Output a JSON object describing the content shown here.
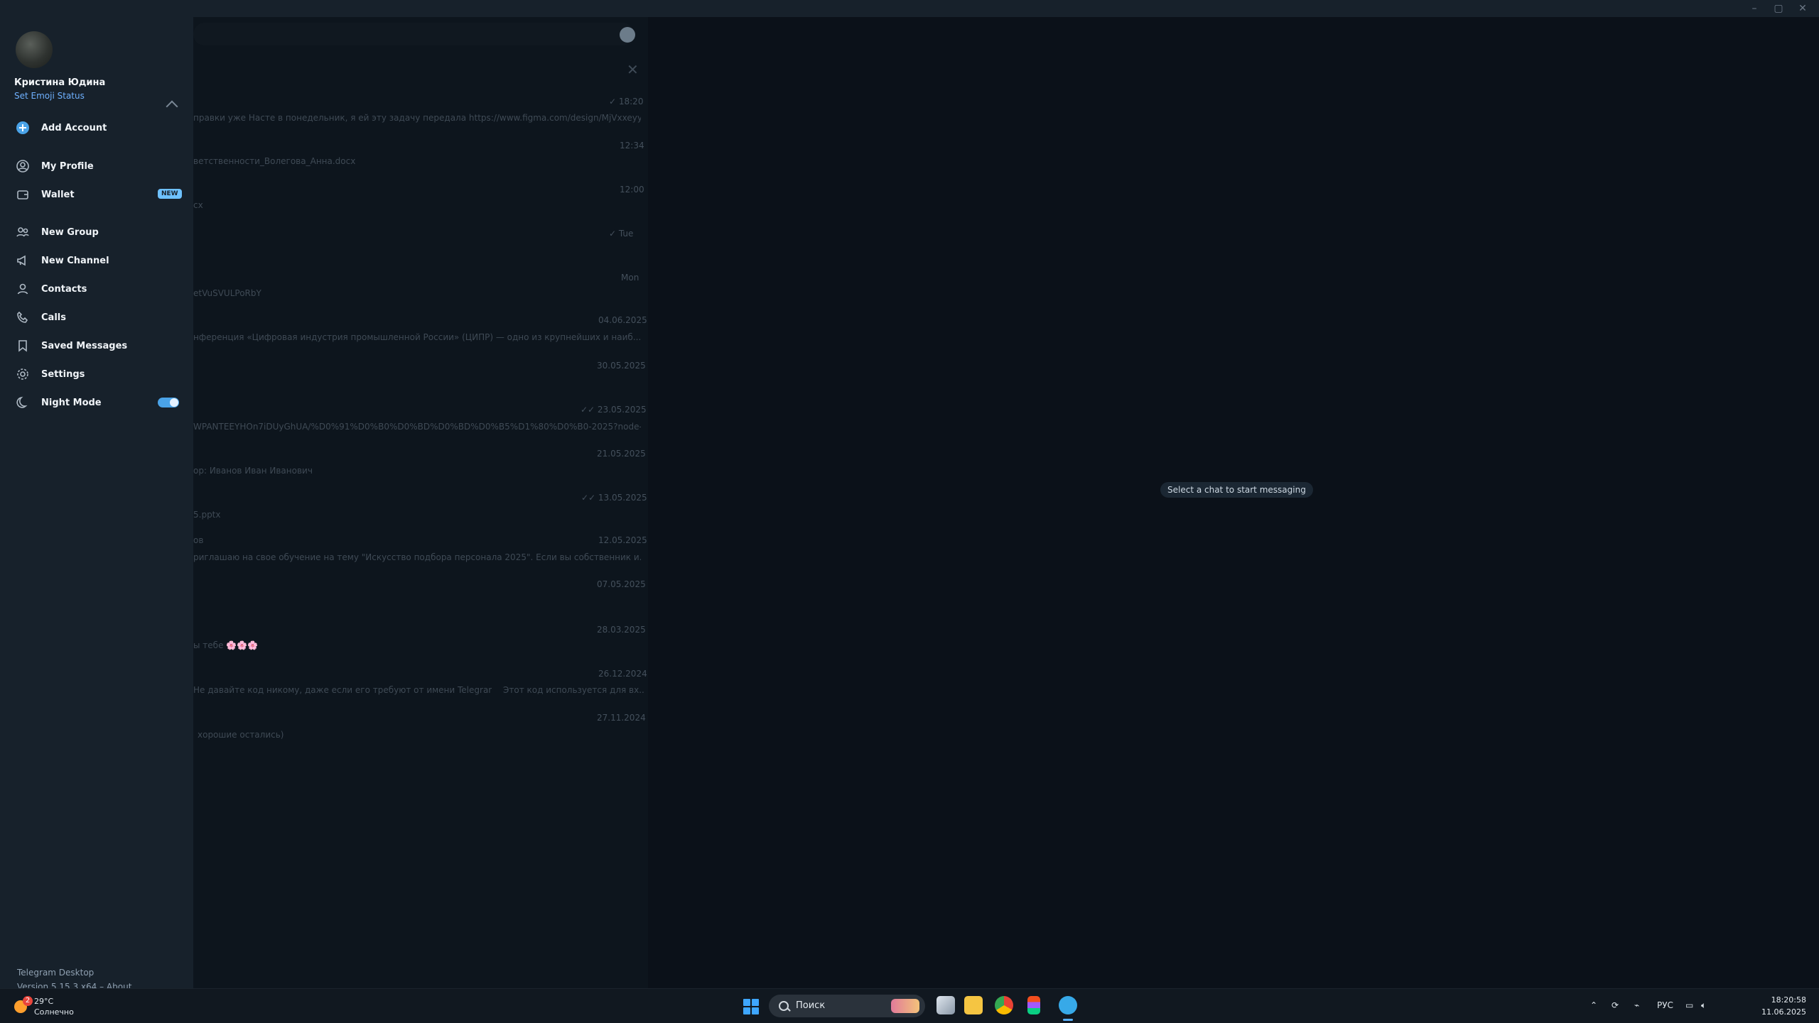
{
  "window_controls": {
    "minimize": "–",
    "maximize": "▢",
    "close": "✕"
  },
  "sidebar": {
    "user_name": "Кристина Юдина",
    "user_status": "Set Emoji Status",
    "items": [
      {
        "label": "Add Account",
        "icon": "plus-circle-icon"
      },
      {
        "label": "My Profile",
        "icon": "profile-icon"
      },
      {
        "label": "Wallet",
        "icon": "wallet-icon",
        "badge": "NEW"
      },
      {
        "label": "New Group",
        "icon": "group-icon"
      },
      {
        "label": "New Channel",
        "icon": "megaphone-icon"
      },
      {
        "label": "Contacts",
        "icon": "contacts-icon"
      },
      {
        "label": "Calls",
        "icon": "phone-icon"
      },
      {
        "label": "Saved Messages",
        "icon": "bookmark-icon"
      },
      {
        "label": "Settings",
        "icon": "gear-icon"
      },
      {
        "label": "Night Mode",
        "icon": "moon-icon",
        "toggle_on": true
      }
    ],
    "footer_title": "Telegram Desktop",
    "footer_version": "Version 5.15.3 x64 – About"
  },
  "chatlist": {
    "rows": [
      {
        "text": "правки уже Насте в понедельник, я ей эту задачу передала  https://www.figma.com/design/MjVxxeyy2...",
        "time": "✓ 18:20"
      },
      {
        "text": "",
        "time": "12:34"
      },
      {
        "text": "ветственности_Волегова_Анна.docx",
        "time": ""
      },
      {
        "text": "",
        "time": "12:00"
      },
      {
        "text": "сх",
        "time": ""
      },
      {
        "text": "",
        "time": "✓ Tue"
      },
      {
        "text": "",
        "time": "Mon"
      },
      {
        "text": "etVuSVULPoRbY",
        "time": ""
      },
      {
        "text": "нференция «Цифровая индустрия промышленной России» (ЦИПР) — одно из крупнейших и наиб...",
        "time": "04.06.2025"
      },
      {
        "text": "",
        "time": "30.05.2025"
      },
      {
        "text": "WPANTEEYHOn7iDUyGhUA/%D0%91%D0%B0%D0%BD%D0%BD%D0%B5%D1%80%D0%B0-2025?node-id...",
        "time": "✓✓ 23.05.2025"
      },
      {
        "text": "",
        "time": "21.05.2025"
      },
      {
        "text": "ор: Иванов Иван Иванович",
        "time": ""
      },
      {
        "text": "",
        "time": "✓✓ 13.05.2025"
      },
      {
        "text": "5.pptx",
        "time": ""
      },
      {
        "text": "ов",
        "time": "12.05.2025"
      },
      {
        "text": "риглашаю на свое обучение на тему \"Искусство подбора персонала 2025\". Если вы собственник и...",
        "time": ""
      },
      {
        "text": "",
        "time": "07.05.2025"
      },
      {
        "text": "",
        "time": "28.03.2025"
      },
      {
        "text": "ы тебе 🌸🌸🌸",
        "time": ""
      },
      {
        "text": "Этот код используется для вх...",
        "time": "26.12.2024"
      },
      {
        "text": "Не давайте код никому, даже если его требуют от имени Telegram!",
        "time": ""
      },
      {
        "text": "",
        "time": "27.11.2024"
      },
      {
        "text": "хорошие остались)",
        "time": ""
      }
    ]
  },
  "main": {
    "empty_hint": "Select a chat to start messaging"
  },
  "taskbar": {
    "weather_temp": "29°C",
    "weather_desc": "Солнечно",
    "weather_badge": "2",
    "search_placeholder": "Поиск",
    "lang": "РУС",
    "time": "18:20:58",
    "date": "11.06.2025"
  },
  "colors": {
    "accent": "#4aa3e8",
    "sidebar_bg": "#17212b",
    "main_bg": "#0b1119"
  }
}
